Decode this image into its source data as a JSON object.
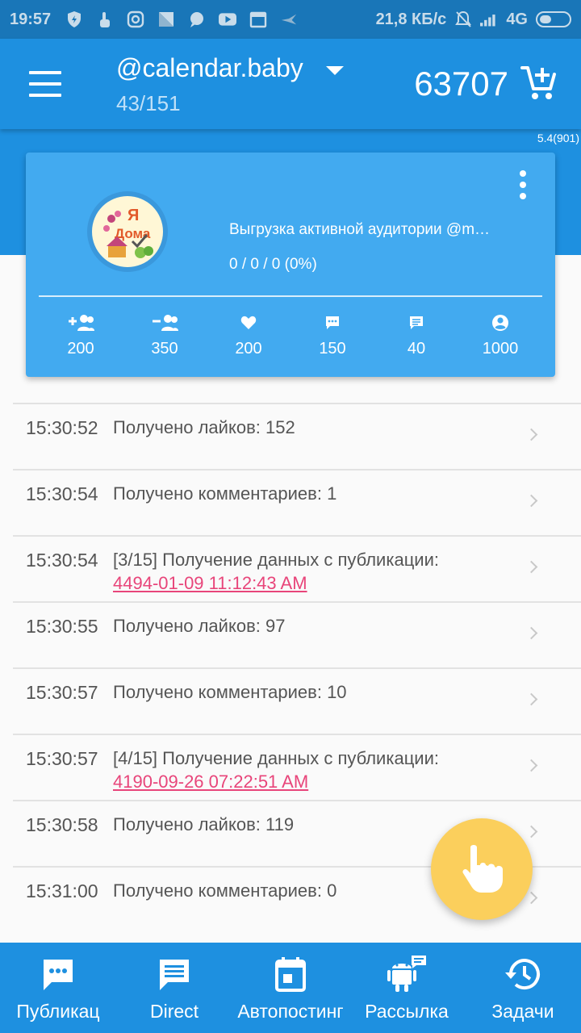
{
  "status_bar": {
    "time": "19:57",
    "network_speed": "21,8 КБ/с",
    "network_type": "4G",
    "icons": [
      "shield-icon",
      "touch-icon",
      "instagram-icon",
      "gallery-icon",
      "chat-icon",
      "youtube-icon",
      "calendar-icon",
      "bird-icon",
      "mute-bell-icon",
      "signal-icon",
      "battery-icon"
    ]
  },
  "header": {
    "account_name": "@calendar.baby",
    "account_counter": "43/151",
    "balance": "63707",
    "version": "5.4(901)"
  },
  "task_card": {
    "title": "Выгрузка активной аудитории @m…",
    "progress": "0 / 0 / 0 (0%)",
    "avatar_icon": "ya-doma-logo",
    "avatar_text": "Я Дома",
    "stats": [
      {
        "icon": "follow-icon",
        "value": "200"
      },
      {
        "icon": "unfollow-icon",
        "value": "350"
      },
      {
        "icon": "like-icon",
        "value": "200"
      },
      {
        "icon": "comment-icon",
        "value": "150"
      },
      {
        "icon": "message-icon",
        "value": "40"
      },
      {
        "icon": "profile-icon",
        "value": "1000"
      }
    ]
  },
  "log": [
    {
      "time": "15:30:52",
      "message": "Получено лайков: 152",
      "link": ""
    },
    {
      "time": "15:30:54",
      "message": "Получено комментариев: 1",
      "link": ""
    },
    {
      "time": "15:30:54",
      "message": "[3/15] Получение данных с публикации:",
      "link": "4494-01-09 11:12:43 AM"
    },
    {
      "time": "15:30:55",
      "message": "Получено лайков: 97",
      "link": ""
    },
    {
      "time": "15:30:57",
      "message": "Получено комментариев: 10",
      "link": ""
    },
    {
      "time": "15:30:57",
      "message": "[4/15] Получение данных с публикации:",
      "link": "4190-09-26 07:22:51 AM"
    },
    {
      "time": "15:30:58",
      "message": "Получено лайков: 119",
      "link": ""
    },
    {
      "time": "15:31:00",
      "message": "Получено комментариев: 0",
      "link": ""
    }
  ],
  "bottom_nav": [
    {
      "label": "Публикац",
      "icon": "publications-icon"
    },
    {
      "label": "Direct",
      "icon": "direct-icon"
    },
    {
      "label": "Автопостинг",
      "icon": "autoposting-icon"
    },
    {
      "label": "Рассылка",
      "icon": "android-mailing-icon"
    },
    {
      "label": "Задачи",
      "icon": "tasks-history-icon"
    }
  ],
  "colors": {
    "status_bar": "#1976b8",
    "app_bar": "#1e90e0",
    "card": "#42aaf0",
    "link": "#e8457a",
    "fab": "#fbcf5c"
  }
}
